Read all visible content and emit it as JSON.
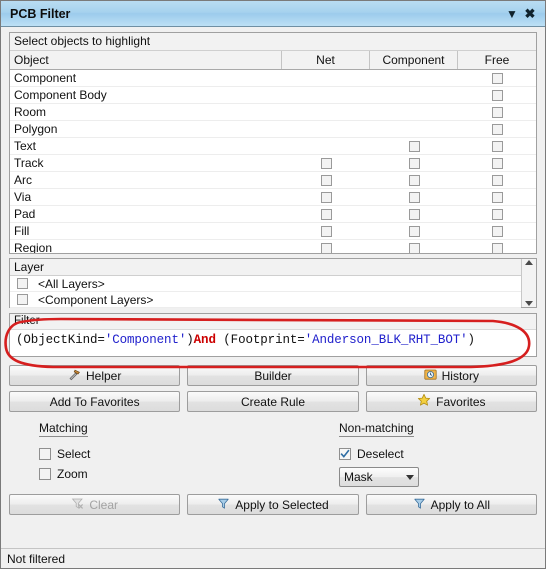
{
  "window": {
    "title": "PCB Filter",
    "dropdown_icon": "chevron-down-icon",
    "close_icon": "close-icon"
  },
  "object_list": {
    "caption": "Select objects to highlight",
    "columns": [
      "Object",
      "Net",
      "Component",
      "Free"
    ],
    "rows": [
      {
        "name": "Component",
        "net": false,
        "component": false,
        "free": true
      },
      {
        "name": "Component Body",
        "net": false,
        "component": false,
        "free": true
      },
      {
        "name": "Room",
        "net": false,
        "component": false,
        "free": true
      },
      {
        "name": "Polygon",
        "net": false,
        "component": false,
        "free": true
      },
      {
        "name": "Text",
        "net": false,
        "component": true,
        "free": true
      },
      {
        "name": "Track",
        "net": true,
        "component": true,
        "free": true
      },
      {
        "name": "Arc",
        "net": true,
        "component": true,
        "free": true
      },
      {
        "name": "Via",
        "net": true,
        "component": true,
        "free": true
      },
      {
        "name": "Pad",
        "net": true,
        "component": true,
        "free": true
      },
      {
        "name": "Fill",
        "net": true,
        "component": true,
        "free": true
      },
      {
        "name": "Region",
        "net": true,
        "component": true,
        "free": true
      }
    ]
  },
  "layer_list": {
    "caption": "Layer",
    "items": [
      {
        "label": "<All Layers>",
        "checked": false
      },
      {
        "label": "<Component Layers>",
        "checked": false
      }
    ],
    "scroll_up_icon": "scroll-up-arrow-icon",
    "scroll_down_icon": "scroll-down-arrow-icon"
  },
  "filter": {
    "caption": "Filter",
    "tokens": [
      {
        "text": "(ObjectKind=",
        "type": "plain"
      },
      {
        "text": "'Component'",
        "type": "string"
      },
      {
        "text": ")",
        "type": "plain"
      },
      {
        "text": "And",
        "type": "keyword"
      },
      {
        "text": "  (Footprint=",
        "type": "plain"
      },
      {
        "text": "'Anderson_BLK_RHT_BOT'",
        "type": "string"
      },
      {
        "text": ")",
        "type": "plain"
      }
    ],
    "expression": "(ObjectKind='Component')And  (Footprint='Anderson_BLK_RHT_BOT')",
    "string_color": "#2020cc",
    "keyword_color": "#cc0000",
    "annotation_color": "#d61f1f"
  },
  "buttons": {
    "row1": [
      {
        "label": "Helper",
        "icon": "hammer-icon",
        "enabled": true
      },
      {
        "label": "Builder",
        "icon": "",
        "enabled": true
      },
      {
        "label": "History",
        "icon": "history-clock-icon",
        "enabled": true
      }
    ],
    "row2": [
      {
        "label": "Add To Favorites",
        "icon": "",
        "enabled": true
      },
      {
        "label": "Create Rule",
        "icon": "",
        "enabled": true
      },
      {
        "label": "Favorites",
        "icon": "star-icon",
        "enabled": true
      }
    ]
  },
  "matching": {
    "label": "Matching",
    "options": [
      {
        "label": "Select",
        "checked": false
      },
      {
        "label": "Zoom",
        "checked": false
      }
    ]
  },
  "non_matching": {
    "label": "Non-matching",
    "option": {
      "label": "Deselect",
      "checked": true
    },
    "mask_select": {
      "value": "Mask",
      "caret_icon": "caret-down-icon"
    }
  },
  "actions": [
    {
      "label": "Clear",
      "icon": "clear-filter-icon",
      "enabled": false
    },
    {
      "label": "Apply to Selected",
      "icon": "funnel-icon",
      "enabled": true
    },
    {
      "label": "Apply to All",
      "icon": "funnel-icon",
      "enabled": true
    }
  ],
  "status": {
    "text": "Not filtered"
  }
}
